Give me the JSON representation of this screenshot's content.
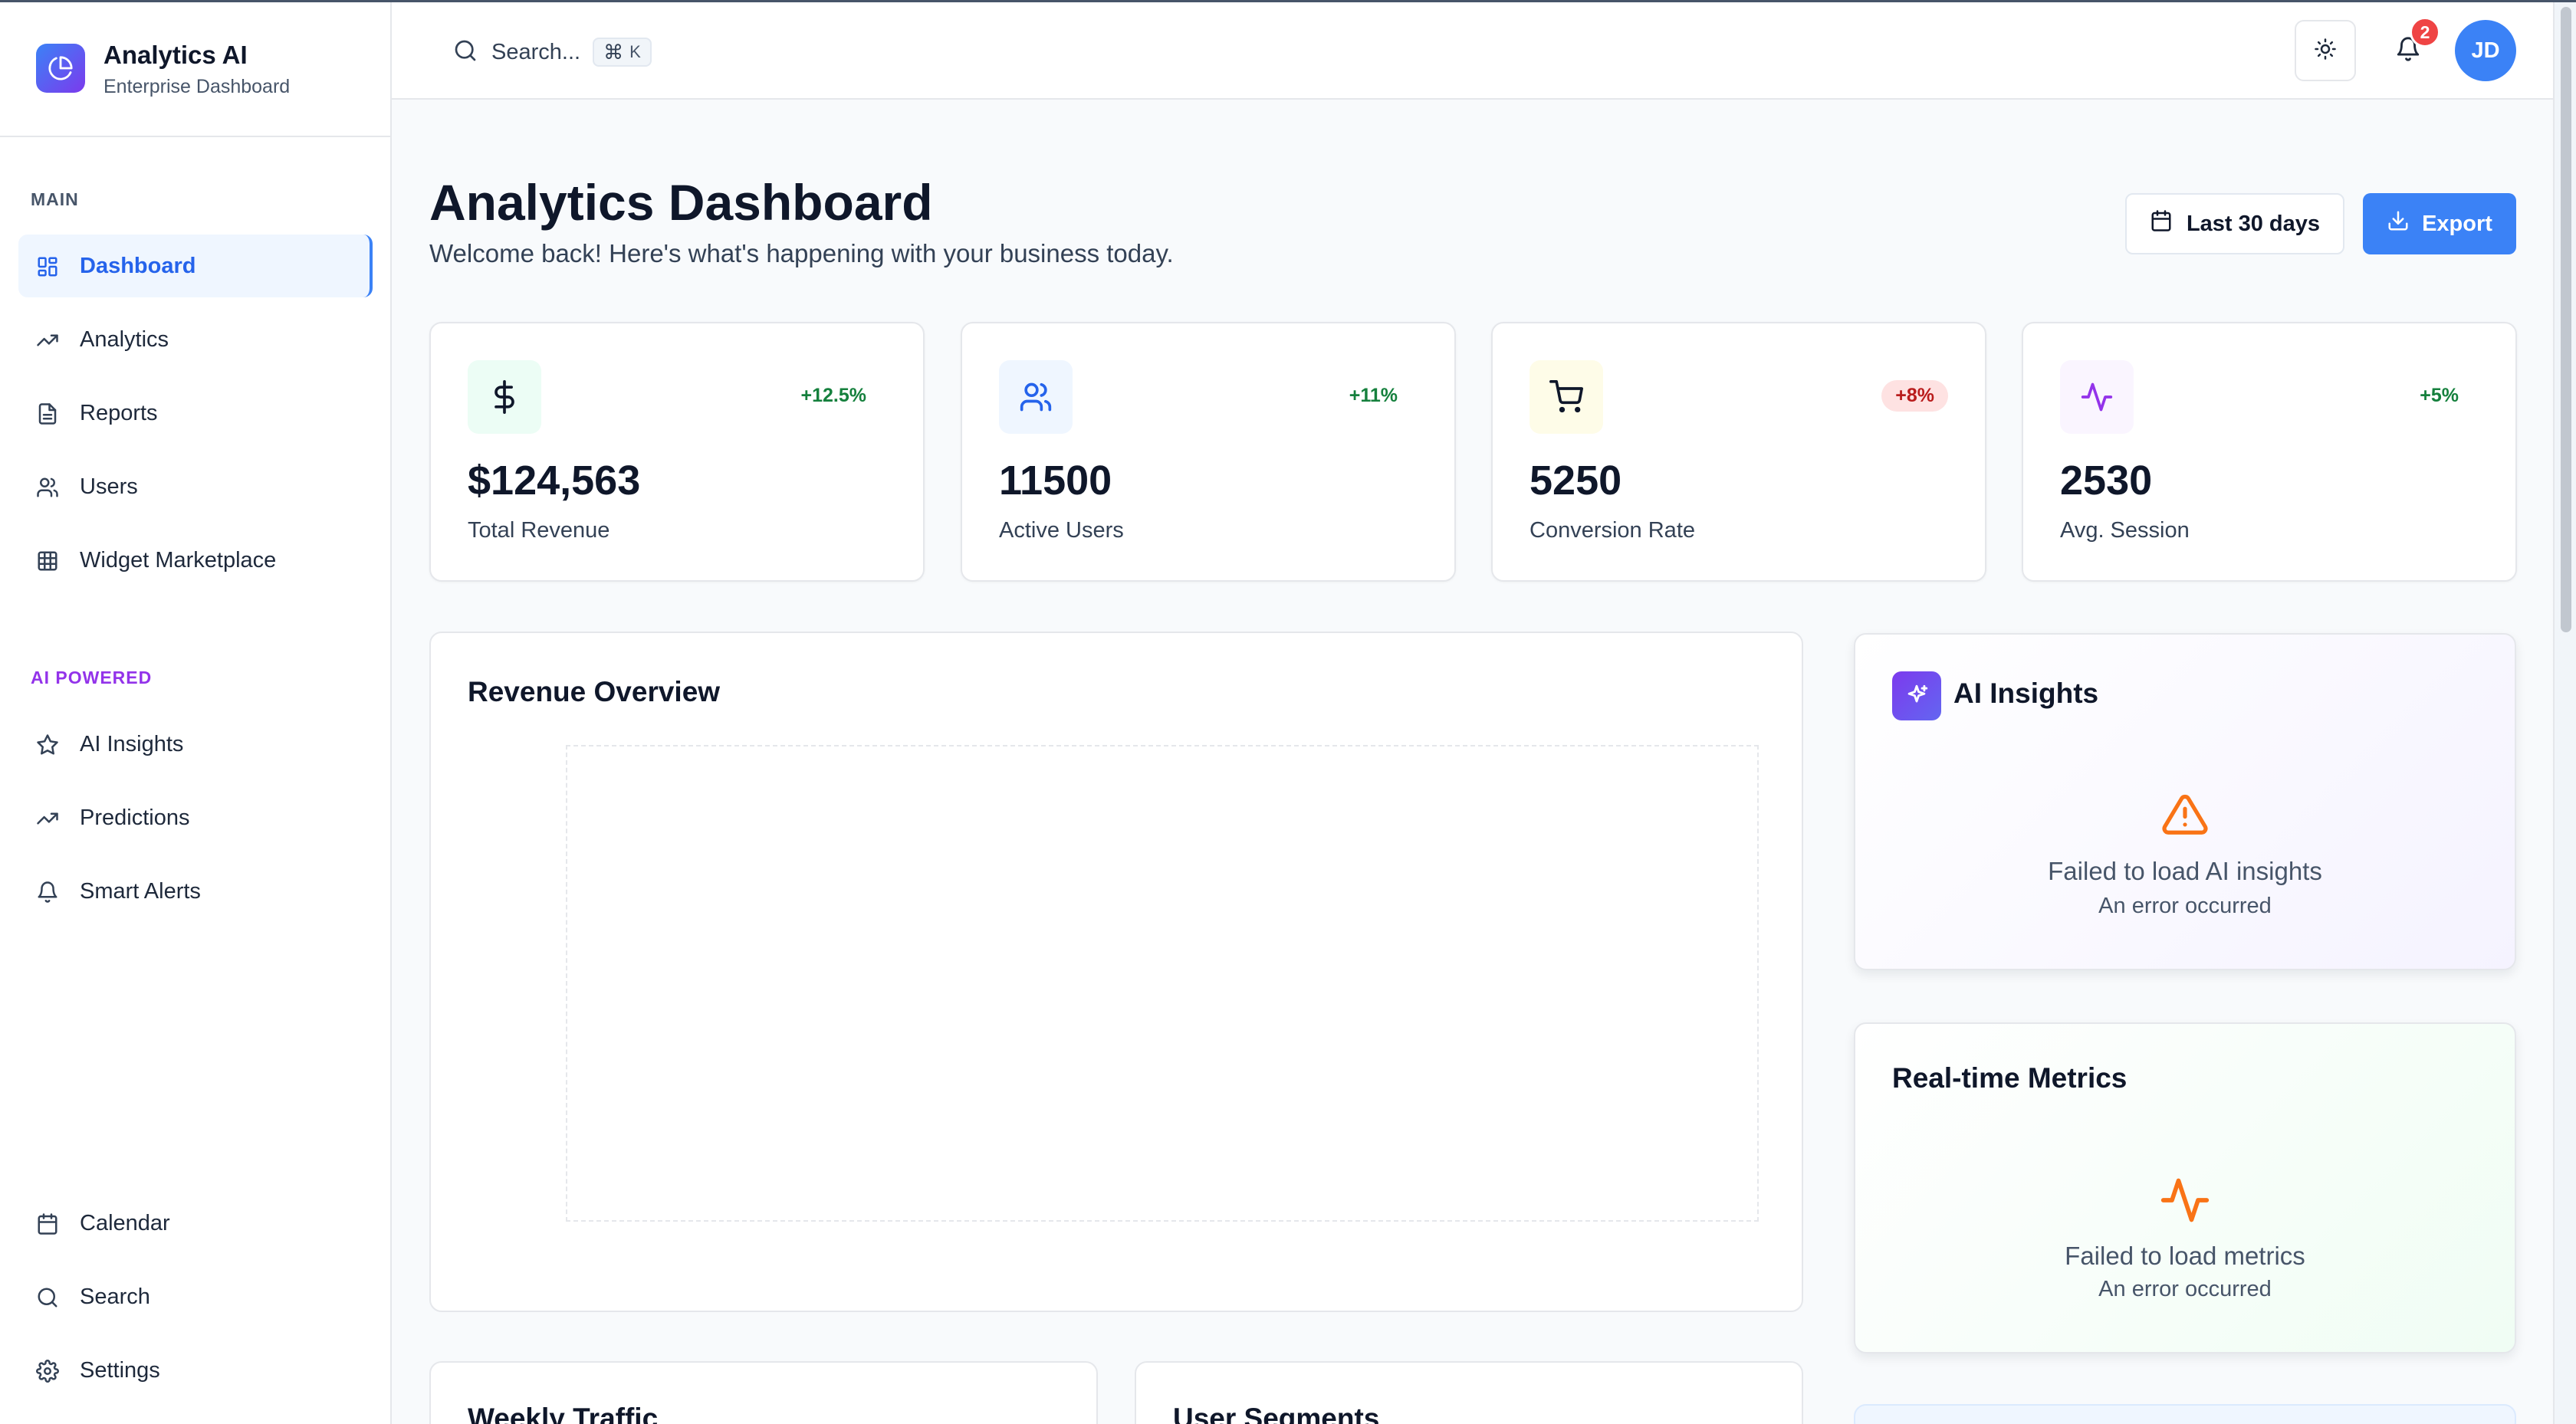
{
  "brand": {
    "title": "Analytics AI",
    "subtitle": "Enterprise Dashboard"
  },
  "sidebar": {
    "main_label": "MAIN",
    "main_items": [
      {
        "label": "Dashboard",
        "icon": "grid-icon",
        "active": true
      },
      {
        "label": "Analytics",
        "icon": "trending-up-icon"
      },
      {
        "label": "Reports",
        "icon": "file-text-icon"
      },
      {
        "label": "Users",
        "icon": "users-icon"
      },
      {
        "label": "Widget Marketplace",
        "icon": "grid-table-icon"
      }
    ],
    "ai_label": "AI POWERED",
    "ai_items": [
      {
        "label": "AI Insights",
        "icon": "star-icon"
      },
      {
        "label": "Predictions",
        "icon": "trending-up-icon"
      },
      {
        "label": "Smart Alerts",
        "icon": "bell-icon"
      }
    ],
    "bottom_items": [
      {
        "label": "Calendar",
        "icon": "calendar-icon"
      },
      {
        "label": "Search",
        "icon": "search-icon"
      },
      {
        "label": "Settings",
        "icon": "gear-icon"
      }
    ]
  },
  "header": {
    "search_placeholder": "Search...",
    "shortcut_key": "K",
    "notification_count": "2",
    "avatar_initials": "JD"
  },
  "page": {
    "title": "Analytics Dashboard",
    "subtitle": "Welcome back! Here's what's happening with your business today.",
    "range_button": "Last 30 days",
    "export_button": "Export"
  },
  "stats": [
    {
      "value": "$124,563",
      "label": "Total Revenue",
      "change": "+12.5%",
      "icon": "dollar-icon"
    },
    {
      "value": "11500",
      "label": "Active Users",
      "change": "+11%",
      "icon": "users-icon"
    },
    {
      "value": "5250",
      "label": "Conversion Rate",
      "change": "+8%",
      "icon": "cart-icon"
    },
    {
      "value": "2530",
      "label": "Avg. Session",
      "change": "+5%",
      "icon": "activity-icon"
    }
  ],
  "revenue_panel": {
    "title": "Revenue Overview"
  },
  "ai_insights": {
    "title": "AI Insights",
    "error_title": "Failed to load AI insights",
    "error_sub": "An error occurred"
  },
  "realtime": {
    "title": "Real-time Metrics",
    "error_title": "Failed to load metrics",
    "error_sub": "An error occurred"
  },
  "bottom_cards": {
    "weekly": "Weekly Traffic",
    "segments": "User Segments"
  },
  "colors": {
    "primary": "#3b82f6",
    "ai_purple": "#7c3aed",
    "error_orange": "#f97316",
    "positive": "#15803d",
    "negative": "#b91c1c"
  }
}
